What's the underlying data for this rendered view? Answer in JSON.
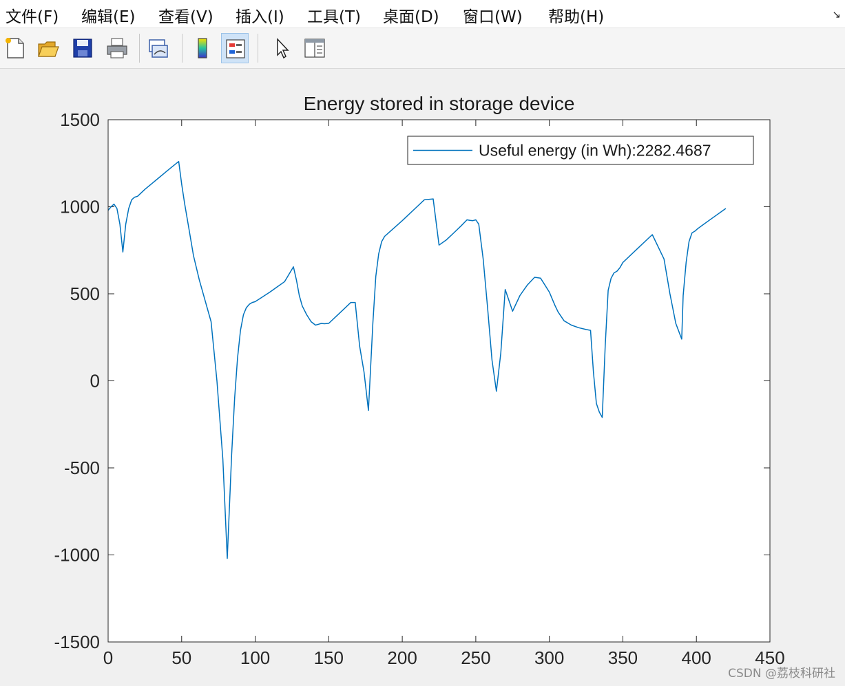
{
  "menubar": {
    "items": [
      {
        "label": "文件(F)"
      },
      {
        "label": "编辑(E)"
      },
      {
        "label": "查看(V)"
      },
      {
        "label": "插入(I)"
      },
      {
        "label": "工具(T)"
      },
      {
        "label": "桌面(D)"
      },
      {
        "label": "窗口(W)"
      },
      {
        "label": "帮助(H)"
      }
    ]
  },
  "toolbar": {
    "buttons": [
      {
        "icon": "new-figure-icon"
      },
      {
        "icon": "open-folder-icon"
      },
      {
        "icon": "save-icon"
      },
      {
        "icon": "print-icon"
      },
      {
        "icon": "link-plot-icon"
      },
      {
        "icon": "colorbar-icon"
      },
      {
        "icon": "legend-icon",
        "active": true
      },
      {
        "icon": "pointer-icon"
      },
      {
        "icon": "property-editor-icon"
      }
    ]
  },
  "chart_data": {
    "type": "line",
    "title": "Energy stored in storage device",
    "xlabel": "",
    "ylabel": "",
    "xlim": [
      0,
      450
    ],
    "ylim": [
      -1500,
      1500
    ],
    "xticks": [
      0,
      50,
      100,
      150,
      200,
      250,
      300,
      350,
      400,
      450
    ],
    "yticks": [
      -1500,
      -1000,
      -500,
      0,
      500,
      1000,
      1500
    ],
    "grid": false,
    "legend_position": "top-right",
    "series": [
      {
        "name": "Useful energy (in Wh):2282.4687",
        "color": "#0072bd",
        "x": [
          0,
          2,
          4,
          6,
          8,
          10,
          12,
          14,
          16,
          18,
          20,
          25,
          30,
          35,
          40,
          45,
          48,
          50,
          52,
          55,
          58,
          62,
          66,
          70,
          74,
          78,
          81,
          84,
          86,
          88,
          90,
          92,
          94,
          96,
          98,
          100,
          110,
          115,
          120,
          126,
          128,
          130,
          132,
          135,
          138,
          141,
          143,
          145,
          147,
          150,
          155,
          160,
          165,
          168,
          171,
          174,
          177,
          180,
          182,
          184,
          186,
          188,
          190,
          200,
          205,
          210,
          215,
          221,
          225,
          230,
          235,
          240,
          244,
          246,
          248,
          250,
          252,
          255,
          258,
          261,
          264,
          267,
          270,
          275,
          280,
          285,
          290,
          294,
          300,
          302,
          304,
          306,
          308,
          310,
          315,
          320,
          325,
          328,
          330,
          332,
          334,
          336,
          338,
          340,
          342,
          344,
          346,
          348,
          350,
          360,
          370,
          378,
          382,
          386,
          390,
          391,
          393,
          395,
          397,
          399,
          401,
          410,
          420
        ],
        "y": [
          980,
          1000,
          1015,
          990,
          900,
          740,
          900,
          990,
          1040,
          1055,
          1060,
          1100,
          1135,
          1170,
          1205,
          1240,
          1260,
          1130,
          1020,
          870,
          720,
          580,
          460,
          340,
          0,
          -450,
          -1020,
          -420,
          -100,
          130,
          290,
          380,
          420,
          440,
          450,
          455,
          510,
          540,
          570,
          655,
          580,
          490,
          430,
          380,
          340,
          320,
          325,
          330,
          328,
          330,
          370,
          410,
          450,
          450,
          200,
          50,
          -170,
          330,
          600,
          730,
          800,
          830,
          845,
          920,
          960,
          1000,
          1040,
          1045,
          780,
          810,
          850,
          890,
          925,
          922,
          920,
          925,
          900,
          700,
          420,
          120,
          -60,
          160,
          525,
          400,
          490,
          550,
          595,
          590,
          510,
          470,
          430,
          395,
          370,
          345,
          320,
          305,
          295,
          290,
          50,
          -130,
          -180,
          -210,
          200,
          520,
          590,
          620,
          630,
          650,
          680,
          760,
          840,
          700,
          500,
          330,
          240,
          490,
          680,
          800,
          850,
          860,
          875,
          930,
          990
        ]
      }
    ]
  },
  "watermark": "CSDN @荔枝科研社"
}
